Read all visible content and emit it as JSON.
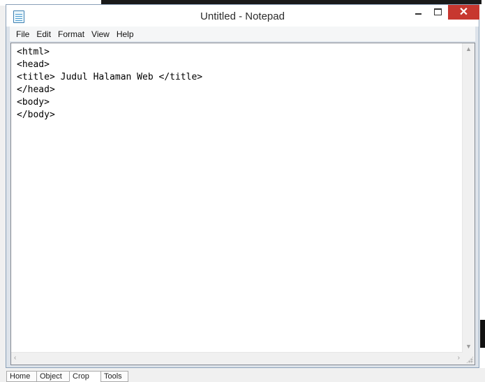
{
  "window": {
    "title": "Untitled - Notepad",
    "close_glyph": "✕"
  },
  "menu": [
    {
      "label": "File"
    },
    {
      "label": "Edit"
    },
    {
      "label": "Format"
    },
    {
      "label": "View"
    },
    {
      "label": "Help"
    }
  ],
  "editor": {
    "content": "<html>\n<head>\n<title> Judul Halaman Web </title>\n</head>\n<body>\n</body>"
  },
  "background_tabs": [
    {
      "label": "Home"
    },
    {
      "label": "Object"
    },
    {
      "label": "Crop"
    },
    {
      "label": "Tools"
    }
  ],
  "icons": {
    "app": "notepad-icon",
    "minimize": "minimize-icon",
    "maximize": "maximize-icon",
    "close": "close-icon"
  },
  "colors": {
    "close_button": "#c7372f",
    "window_border": "#8aa0b8"
  }
}
